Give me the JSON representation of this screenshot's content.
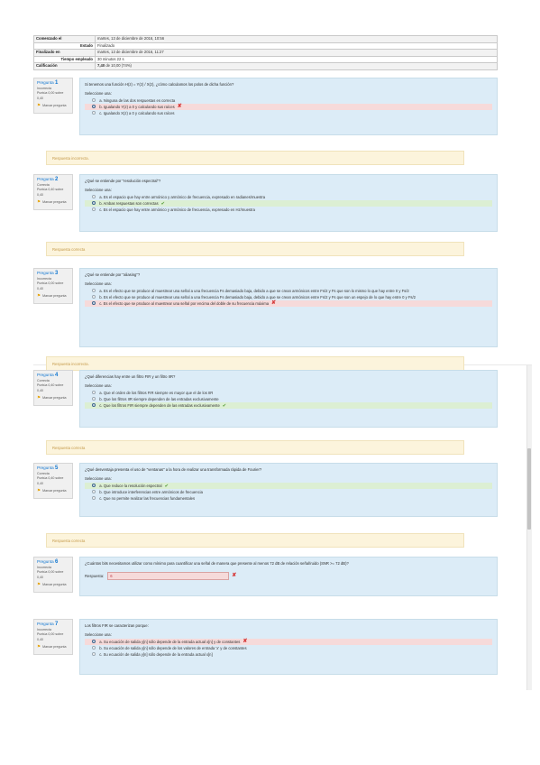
{
  "summary": [
    {
      "key": "Comenzado el",
      "value": "martes, 13 de diciembre de 2016, 10:56",
      "align": "left"
    },
    {
      "key": "Estado",
      "value": "Finalizado",
      "align": "right"
    },
    {
      "key": "Finalizado en",
      "value": "martes, 13 de diciembre de 2016, 11:27",
      "align": "left"
    },
    {
      "key": "Tiempo empleado",
      "value": "30 minutos 22 s",
      "align": "right"
    },
    {
      "key": "Calificación",
      "value_bold": "7,40",
      "value_rest": " de 10,00 (74%)",
      "align": "left"
    }
  ],
  "flag_label": "Marcar pregunta",
  "questions": [
    {
      "label": "Pregunta",
      "number": "1",
      "state": "Incorrecta",
      "grade": "Puntúa 0,00 sobre 0,40",
      "text": "Si tenemos una función H(z) = Y(z) / X(z), ¿cómo calculamos los polos de dicha función?",
      "prompt": "Seleccione una:",
      "options": [
        {
          "text": "a. Ninguna de las dos respuestas es correcta",
          "selected": false,
          "status": ""
        },
        {
          "text": "b. Igualando Y(z) a 0 y calculando sus raíces",
          "selected": true,
          "status": "incorrect"
        },
        {
          "text": "c. Igualando X(z) a 0 y calculando sus raíces",
          "selected": false,
          "status": ""
        }
      ],
      "feedback": "Respuesta incorrecta."
    },
    {
      "label": "Pregunta",
      "number": "2",
      "state": "Correcta",
      "grade": "Puntúa 0,40 sobre 0,40",
      "text": "¿Qué se entiende por \"resolución espectral\"?",
      "prompt": "Seleccione una:",
      "options": [
        {
          "text": "a. Es el espacio que hay entre armónico y armónico de frecuencia, expresado en radianes/muestra",
          "selected": false,
          "status": ""
        },
        {
          "text": "b. Ambas respuestas son correctas",
          "selected": true,
          "status": "correct"
        },
        {
          "text": "c. Es el espacio que hay entre armónico y armónico de frecuencia, expresado en Hz/muestra",
          "selected": false,
          "status": ""
        }
      ],
      "feedback": "Respuesta correcta"
    },
    {
      "label": "Pregunta",
      "number": "3",
      "state": "Incorrecta",
      "grade": "Puntúa 0,00 sobre 0,40",
      "text": "¿Qué se entiende por \"aliasing\"?",
      "prompt": "Seleccione una:",
      "options": [
        {
          "text": "a. Es el efecto que se produce al muestrear una señal a una frecuencia Fs demasiado baja, debido a que se crean armónicos entre Fs/2 y Fs que son lo mismo lo que hay entre 0 y Fs/2",
          "selected": false,
          "status": ""
        },
        {
          "text": "b. Es el efecto que se produce al muestrear una señal a una frecuencia Fs demasiado baja, debido a que se crean armónicos entre Fs/2 y Fs que son un espejo de lo que hay entre 0 y Fs/2",
          "selected": false,
          "status": ""
        },
        {
          "text": "c. Es el efecto que se produce al muestrear una señal por encima del doble de su frecuencia máxima",
          "selected": true,
          "status": "incorrect"
        }
      ],
      "feedback": "Respuesta incorrecta."
    },
    {
      "label": "Pregunta",
      "number": "4",
      "state": "Correcta",
      "grade": "Puntúa 0,40 sobre 0,40",
      "text": "¿Qué diferencias hay entre un filtro FIR y un filtro IIR?",
      "prompt": "Seleccione una:",
      "options": [
        {
          "text": "a. Que el orden de los filtros FIR siempre es mayor que el de los IIR",
          "selected": false,
          "status": ""
        },
        {
          "text": "b. Que los filtros IIR siempre dependen de las entradas exclusivamente",
          "selected": false,
          "status": ""
        },
        {
          "text": "c. Que los filtros FIR siempre dependen de las entradas exclusivamente",
          "selected": true,
          "status": "correct"
        }
      ],
      "feedback": "Respuesta correcta"
    },
    {
      "label": "Pregunta",
      "number": "5",
      "state": "Correcta",
      "grade": "Puntúa 0,40 sobre 0,40",
      "text": "¿Qué desventaja presenta el uso de \"ventanas\" a la hora de realizar una transformada rápida de Fourier?",
      "prompt": "Seleccione una:",
      "options": [
        {
          "text": "a. Que reduce la resolución espectral",
          "selected": true,
          "status": "correct"
        },
        {
          "text": "b. Que introduce interferencias entre armónicos de frecuencia",
          "selected": false,
          "status": ""
        },
        {
          "text": "c. Que no permite realizar las frecuencias fundamentales",
          "selected": false,
          "status": ""
        }
      ],
      "feedback": "Respuesta correcta"
    },
    {
      "label": "Pregunta",
      "number": "6",
      "state": "Incorrecta",
      "grade": "Puntúa 0,00 sobre 0,40",
      "text": "¿Cuántos bits necesitamos utilizar como mínimo para cuantificar una señal de manera que presente al menos 72 dB de relación señal/ruido (SNR >= 72 dB)?",
      "answer_label": "Respuesta:",
      "answer_value": "6"
    },
    {
      "label": "Pregunta",
      "number": "7",
      "state": "Incorrecta",
      "grade": "Puntúa 0,00 sobre 0,40",
      "text": "Los filtros FIR se caracterizan porque:",
      "prompt": "Seleccione una:",
      "options": [
        {
          "text": "a. Su ecuación de salida y[n] sólo depende de la entrada actual x[n] y de constantes",
          "selected": true,
          "status": "incorrect"
        },
        {
          "text": "b. Su ecuación de salida y[n] sólo depende de los valores de entrada 'x' y de constantes",
          "selected": false,
          "status": ""
        },
        {
          "text": "c. Su ecuación de salida y[n] sólo depende de la entrada actual x[n]",
          "selected": false,
          "status": ""
        }
      ]
    }
  ],
  "icons": {
    "flag": "flag-icon",
    "incorrect": "cross-icon",
    "correct": "check-icon"
  },
  "colors": {
    "info_bg": "#dcecf7",
    "feedback_bg": "#fcf4dc",
    "incorrect_bg": "#f6dada",
    "correct_bg": "#dcefd3",
    "link": "#1177d1"
  }
}
